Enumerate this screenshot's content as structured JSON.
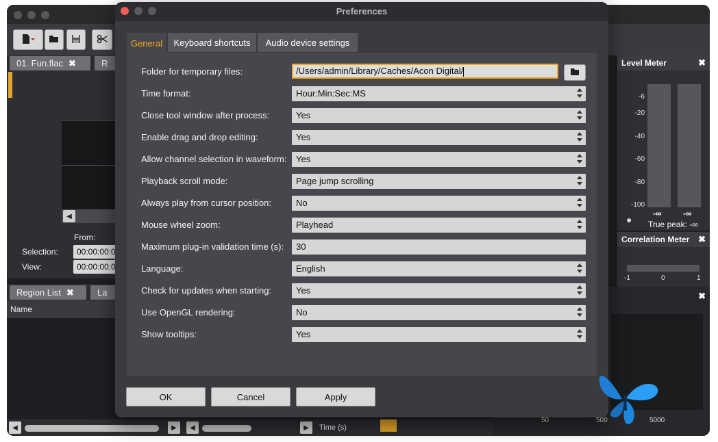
{
  "app": {
    "doc_tab": "01. Fun.flac",
    "doc_tab_2": "R",
    "region_tab": "Region List",
    "region_tab_2": "La",
    "from_label": "From:",
    "selection_label": "Selection:",
    "view_label": "View:",
    "selection_value": "00:00:00:0",
    "view_value": "00:00:00:0",
    "name_header": "Name",
    "time_label": "Time (s)"
  },
  "level_meter": {
    "title": "Level Meter",
    "ticks": [
      "-6",
      "-20",
      "-40",
      "-60",
      "-80",
      "-100"
    ],
    "left_peak": "-∞",
    "right_peak": "-∞",
    "true_peak_label": "True peak: -∞"
  },
  "correlation_meter": {
    "title": "Correlation Meter",
    "scale": [
      "-1",
      "0",
      "1"
    ]
  },
  "spectrum": {
    "scale": [
      "50",
      "500",
      "5000"
    ]
  },
  "dialog": {
    "title": "Preferences",
    "tabs": [
      "General",
      "Keyboard shortcuts",
      "Audio device settings"
    ],
    "active_tab": "General",
    "rows": [
      {
        "label": "Folder for temporary files:",
        "value": "/Users/admin/Library/Caches/Acon Digital/"
      },
      {
        "label": "Time format:",
        "value": "Hour:Min:Sec:MS"
      },
      {
        "label": "Close tool window after process:",
        "value": "Yes"
      },
      {
        "label": "Enable drag and drop editing:",
        "value": "Yes"
      },
      {
        "label": "Allow channel selection in waveform:",
        "value": "Yes"
      },
      {
        "label": "Playback scroll mode:",
        "value": "Page jump scrolling"
      },
      {
        "label": "Always play from cursor position:",
        "value": "No"
      },
      {
        "label": "Mouse wheel zoom:",
        "value": "Playhead"
      },
      {
        "label": "Maximum plug-in validation time (s):",
        "value": "30"
      },
      {
        "label": "Language:",
        "value": "English"
      },
      {
        "label": "Check for updates when starting:",
        "value": "Yes"
      },
      {
        "label": "Use OpenGL rendering:",
        "value": "No"
      },
      {
        "label": "Show tooltips:",
        "value": "Yes"
      }
    ],
    "buttons": {
      "ok": "OK",
      "cancel": "Cancel",
      "apply": "Apply"
    }
  },
  "colors": {
    "accent": "#f0a91f",
    "dialog_bg": "#3a3b3f",
    "panel_bg": "#45474c"
  },
  "icons": [
    "new-file-icon",
    "open-folder-icon",
    "save-icon",
    "scissors-icon",
    "close-icon",
    "folder-icon",
    "wrench-icon",
    "butterfly-logo"
  ]
}
